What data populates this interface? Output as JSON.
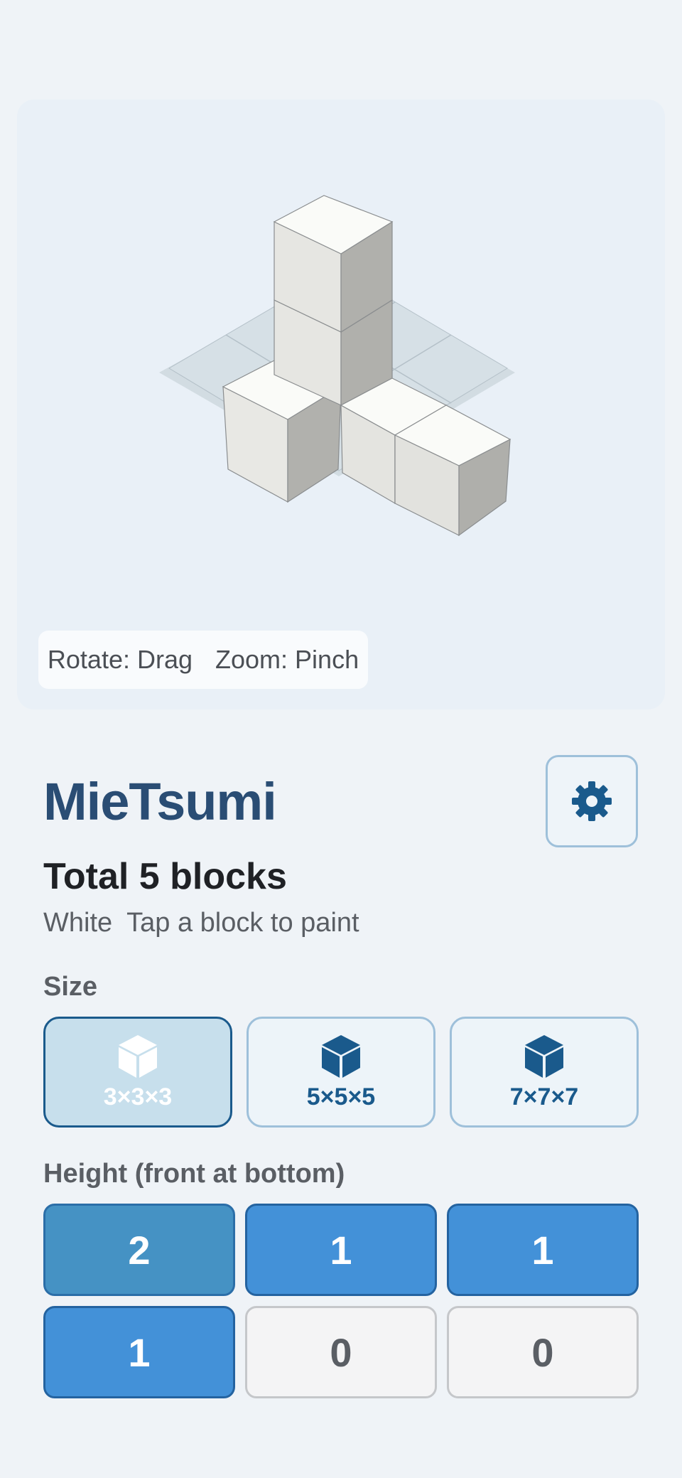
{
  "viewer": {
    "hint_rotate": "Rotate: Drag",
    "hint_zoom": "Zoom: Pinch"
  },
  "header": {
    "title": "MieTsumi",
    "settings_icon": "gear-icon"
  },
  "summary": {
    "total": "Total 5 blocks",
    "color_name": "White",
    "instruction": "Tap a block to paint"
  },
  "size": {
    "label": "Size",
    "options": [
      {
        "label": "3×3×3",
        "icon": "cube-icon",
        "selected": true
      },
      {
        "label": "5×5×5",
        "icon": "cube-icon",
        "selected": false
      },
      {
        "label": "7×7×7",
        "icon": "cube-icon",
        "selected": false
      }
    ]
  },
  "height": {
    "label": "Height (front at bottom)",
    "cells": [
      "2",
      "1",
      "1",
      "1",
      "0",
      "0"
    ]
  },
  "colors": {
    "accent": "#1a5a8c",
    "title": "#2a4d74",
    "active_cell": "#4391d8"
  }
}
